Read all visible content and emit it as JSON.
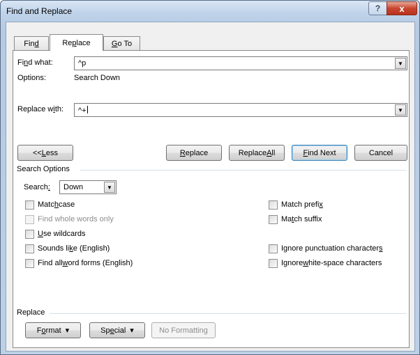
{
  "window": {
    "title": "Find and Replace",
    "help_glyph": "?",
    "close_glyph": "x"
  },
  "tabs": [
    {
      "label_pre": "Fin",
      "label_u": "d",
      "label_post": ""
    },
    {
      "label_pre": "Re",
      "label_u": "p",
      "label_post": "lace"
    },
    {
      "label_pre": "",
      "label_u": "G",
      "label_post": "o To"
    }
  ],
  "find": {
    "label_pre": "Fi",
    "label_u": "n",
    "label_post": "d what:",
    "value": "^p",
    "options_label": "Options:",
    "options_value": "Search Down"
  },
  "replace_with": {
    "label_pre": "Replace w",
    "label_u": "i",
    "label_post": "th:",
    "value": "^+"
  },
  "buttons": {
    "less_pre": "<< ",
    "less_u": "L",
    "less_post": "ess",
    "replace_u": "R",
    "replace_post": "eplace",
    "replace_all_pre": "Replace ",
    "replace_all_u": "A",
    "replace_all_post": "ll",
    "find_next_u": "F",
    "find_next_post": "ind Next",
    "cancel": "Cancel"
  },
  "search_options": {
    "heading": "Search Options",
    "search_label_pre": "Search",
    "search_label_u": ":",
    "search_value": "Down",
    "left": [
      {
        "pre": "Matc",
        "u": "h",
        "post": " case",
        "disabled": false
      },
      {
        "pre": "Find whole words only",
        "u": "",
        "post": "",
        "disabled": true
      },
      {
        "pre": "",
        "u": "U",
        "post": "se wildcards",
        "disabled": false
      },
      {
        "pre": "Sounds li",
        "u": "k",
        "post": "e (English)",
        "disabled": false
      },
      {
        "pre": "Find all ",
        "u": "w",
        "post": "ord forms (English)",
        "disabled": false
      }
    ],
    "right": [
      {
        "pre": "Match prefi",
        "u": "x",
        "post": ""
      },
      {
        "pre": "Ma",
        "u": "t",
        "post": "ch suffix"
      },
      {
        "pre": "Ignore punctuation character",
        "u": "s",
        "post": ""
      },
      {
        "pre": "Ignore ",
        "u": "w",
        "post": "hite-space characters"
      }
    ]
  },
  "replace_section": {
    "heading": "Replace",
    "format_pre": "F",
    "format_u": "o",
    "format_post": "rmat",
    "special_pre": "Sp",
    "special_u": "e",
    "special_post": "cial",
    "no_formatting": "No Formatting",
    "dropdown_glyph": "▾"
  }
}
